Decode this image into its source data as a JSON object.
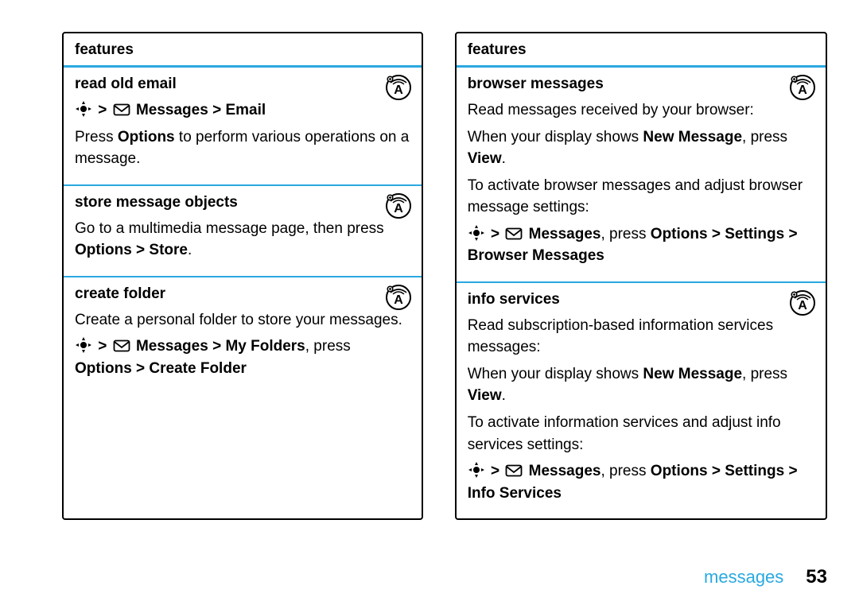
{
  "left": {
    "header": "features",
    "sections": [
      {
        "title": "read old email",
        "path_bold": "Messages > Email",
        "body_pre": "Press ",
        "body_bold": "Options",
        "body_post": " to perform various operations on a message."
      },
      {
        "title": "store message objects",
        "body1": "Go to a multimedia message page, then press ",
        "body1_bold": "Options > Store",
        "body1_post": "."
      },
      {
        "title": "create folder",
        "body1": "Create a personal folder to store your messages.",
        "path_pre_bold": "Messages > My Folders",
        "path_mid": ", press ",
        "path_bold2": "Options > Create Folder"
      }
    ]
  },
  "right": {
    "header": "features",
    "sections": [
      {
        "title": "browser messages",
        "l1": "Read messages received by your browser:",
        "l2_pre": "When your display shows ",
        "l2_b1": "New Message",
        "l2_mid": ", press ",
        "l2_b2": "View",
        "l2_post": ".",
        "l3": "To activate browser messages and adjust browser message settings:",
        "path_b1": "Messages",
        "path_mid": ", press ",
        "path_b2": "Options > Settings > Browser Messages"
      },
      {
        "title": "info services",
        "l1": "Read subscription-based information services messages:",
        "l2_pre": "When your display shows ",
        "l2_b1": "New Message",
        "l2_mid": ", press ",
        "l2_b2": "View",
        "l2_post": ".",
        "l3": "To activate information services and adjust info services settings:",
        "path_b1": "Messages",
        "path_mid": ", press ",
        "path_b2": "Options > Settings > Info Services"
      }
    ]
  },
  "footer": {
    "label": "messages",
    "page": "53"
  },
  "glyphs": {
    "gt": ">"
  }
}
